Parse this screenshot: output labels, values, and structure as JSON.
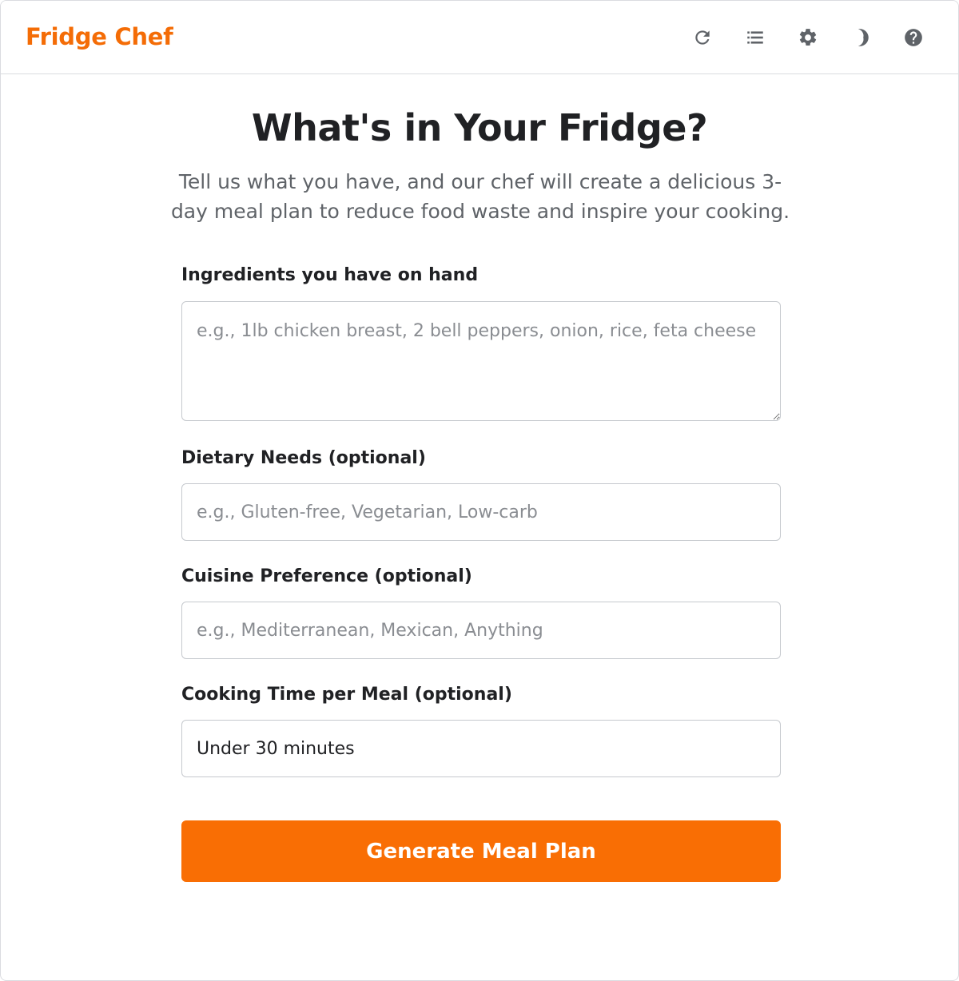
{
  "app": {
    "brand": "Fridge Chef",
    "brand_color": "#f46c06",
    "accent_color": "#f96e04"
  },
  "toolbar": {
    "icons": [
      "refresh-icon",
      "list-icon",
      "gear-icon",
      "moon-icon",
      "help-icon"
    ]
  },
  "hero": {
    "title": "What's in Your Fridge?",
    "subtitle": "Tell us what you have, and our chef will create a delicious 3-day meal plan to reduce food waste and inspire your cooking."
  },
  "form": {
    "ingredients": {
      "label": "Ingredients you have on hand",
      "placeholder": "e.g., 1lb chicken breast, 2 bell peppers, onion, rice, feta cheese",
      "value": ""
    },
    "dietary": {
      "label": "Dietary Needs (optional)",
      "placeholder": "e.g., Gluten-free, Vegetarian, Low-carb",
      "value": ""
    },
    "cuisine": {
      "label": "Cuisine Preference (optional)",
      "placeholder": "e.g., Mediterranean, Mexican, Anything",
      "value": ""
    },
    "cooking_time": {
      "label": "Cooking Time per Meal (optional)",
      "placeholder": "",
      "value": "Under 30 minutes"
    },
    "submit_label": "Generate Meal Plan"
  }
}
